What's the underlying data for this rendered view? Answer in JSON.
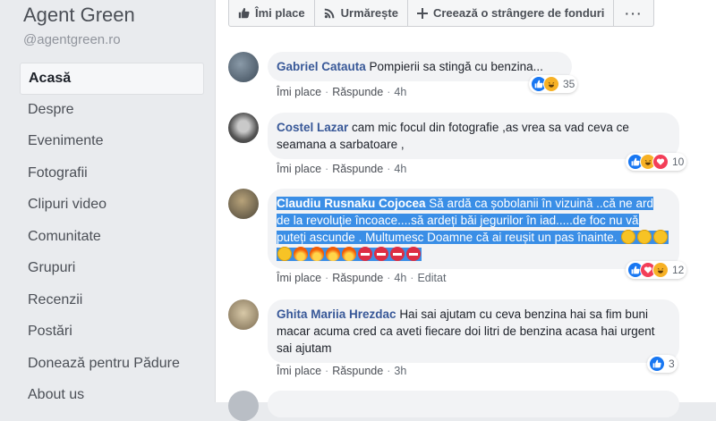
{
  "page": {
    "name": "Agent Green",
    "handle": "@agentgreen.ro"
  },
  "sidebar": {
    "items": [
      {
        "label": "Acasă",
        "active": true
      },
      {
        "label": "Despre"
      },
      {
        "label": "Evenimente"
      },
      {
        "label": "Fotografii"
      },
      {
        "label": "Clipuri video"
      },
      {
        "label": "Comunitate"
      },
      {
        "label": "Grupuri"
      },
      {
        "label": "Recenzii"
      },
      {
        "label": "Postări"
      },
      {
        "label": "Donează pentru Pădure"
      },
      {
        "label": "About us"
      }
    ]
  },
  "toolbar": {
    "like_label": "Îmi place",
    "follow_label": "Urmărește",
    "fundraiser_label": "Creează o strângere de fonduri",
    "more_label": "···",
    "icons": [
      "thumbs-up-icon",
      "rss-icon",
      "plus-icon",
      "more-icon"
    ]
  },
  "actions": {
    "like": "Îmi place",
    "reply": "Răspunde",
    "edited": "Editat"
  },
  "comments": [
    {
      "author": "Gabriel Catauta",
      "text": "Pompierii sa stingă cu benzina...",
      "time": "4h",
      "reactions": [
        "like",
        "haha"
      ],
      "reaction_count": "35"
    },
    {
      "author": "Costel Lazar",
      "text": "cam mic focul din fotografie ,as vrea sa vad ceva ce seamana a sarbatoare ,",
      "time": "4h",
      "reactions": [
        "like",
        "haha",
        "love"
      ],
      "reaction_count": "10"
    },
    {
      "author": "Claudiu Rusnaku Cojocea",
      "text": "Să ardă ca șobolanii în vizuină ..că ne ard de la revoluție încoace....să ardeți băi jegurilor în iad.....de foc nu vă puteți ascunde . Multumesc Doamne că ai reușit un pas înainte.",
      "emojis": [
        "smile",
        "smile",
        "smile",
        "smile",
        "fire",
        "fire",
        "fire",
        "fire",
        "no-entry",
        "no-entry",
        "no-entry",
        "no-entry"
      ],
      "time": "4h",
      "edited": true,
      "selected": true,
      "reactions": [
        "like",
        "love",
        "haha"
      ],
      "reaction_count": "12"
    },
    {
      "author": "Ghita Mariia Hrezdac",
      "text": "Hai sai ajutam cu ceva benzina hai sa fim buni macar acuma cred ca aveti fiecare doi litri de benzina acasa hai urgent sai ajutam",
      "time": "3h",
      "reactions": [
        "like"
      ],
      "reaction_count": "3"
    }
  ],
  "colors": {
    "link": "#385898",
    "like": "#1877f2",
    "haha": "#f7b125",
    "love": "#f33e58",
    "selection": "#3a8ee6"
  }
}
